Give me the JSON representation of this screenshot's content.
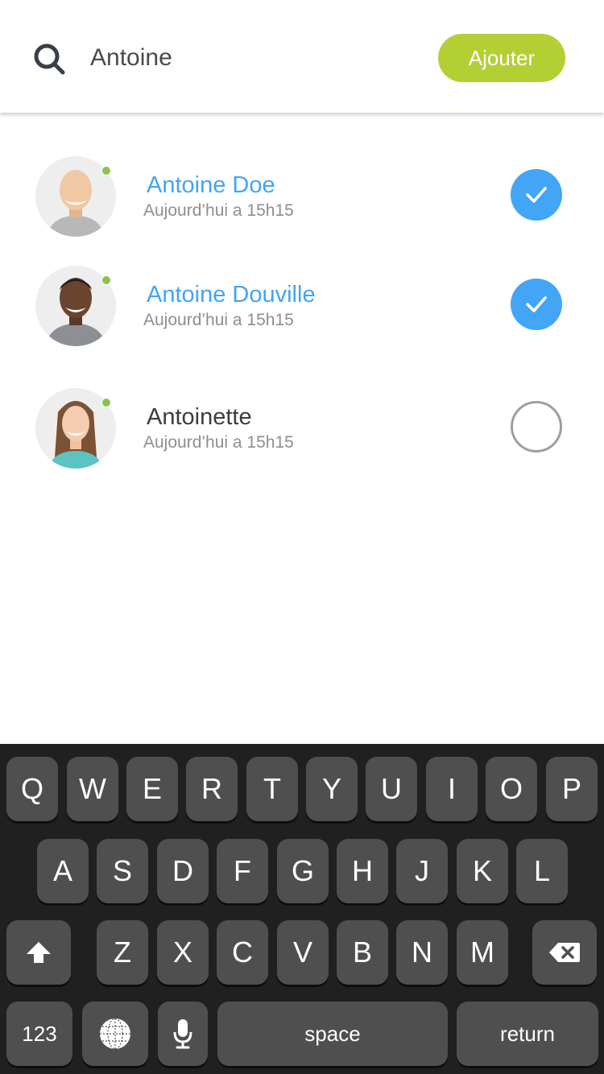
{
  "search": {
    "value": "Antoine"
  },
  "header": {
    "add_label": "Ajouter"
  },
  "colors": {
    "accent_green": "#b3cf34",
    "selected_blue": "#42a5f5",
    "presence_green": "#8bc34a"
  },
  "contacts": [
    {
      "name": "Antoine Doe",
      "time": "Aujourd’hui a 15h15",
      "selected": true,
      "online": true
    },
    {
      "name": "Antoine Douville",
      "time": "Aujourd’hui a 15h15",
      "selected": true,
      "online": true
    },
    {
      "name": "Antoinette",
      "time": "Aujourd’hui a 15h15",
      "selected": false,
      "online": true
    }
  ],
  "keyboard": {
    "row1": [
      "Q",
      "W",
      "E",
      "R",
      "T",
      "Y",
      "U",
      "I",
      "O",
      "P"
    ],
    "row2": [
      "A",
      "S",
      "D",
      "F",
      "G",
      "H",
      "J",
      "K",
      "L"
    ],
    "row3": [
      "Z",
      "X",
      "C",
      "V",
      "B",
      "N",
      "M"
    ],
    "numbers_label": "123",
    "space_label": "space",
    "return_label": "return",
    "icons": {
      "shift": "shift-icon",
      "delete": "backspace-icon",
      "globe": "globe-icon",
      "mic": "microphone-icon"
    }
  }
}
